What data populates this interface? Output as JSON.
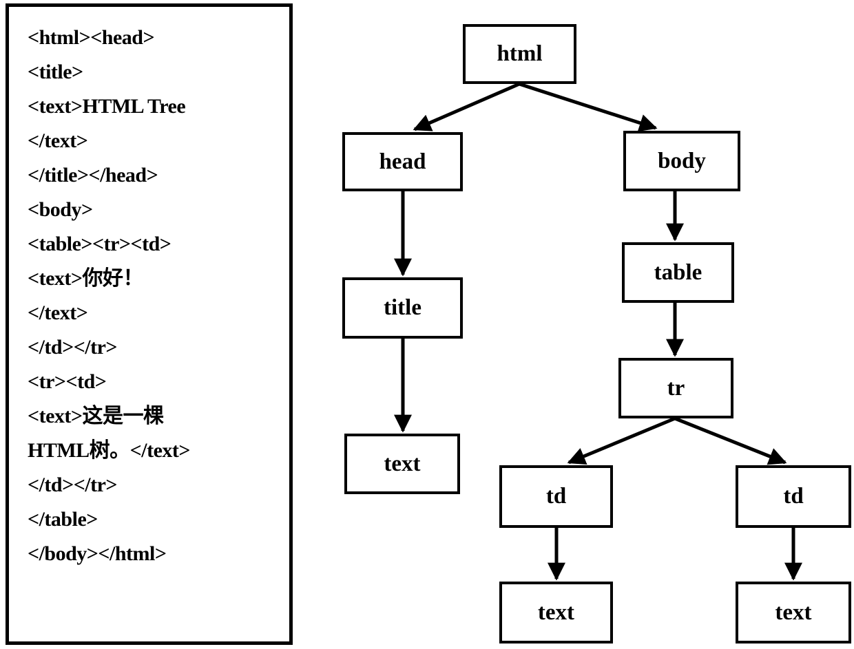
{
  "figure": {
    "kind": "html-dom-tree-diagram",
    "background": "#ffffff",
    "ink": "#000000"
  },
  "code_panel": {
    "lines": [
      "<html><head>",
      "<title>",
      "<text>HTML Tree",
      "</text>",
      "</title></head>",
      "<body>",
      "<table><tr><td>",
      "<text>你好！",
      "</text>",
      "</td></tr>",
      "<tr><td>",
      "<text>这是一棵",
      "HTML树。</text>",
      "</td></tr>",
      "</table>",
      "</body></html>"
    ]
  },
  "tree": {
    "nodes": [
      {
        "id": "html",
        "label": "html"
      },
      {
        "id": "head",
        "label": "head"
      },
      {
        "id": "body",
        "label": "body"
      },
      {
        "id": "title",
        "label": "title"
      },
      {
        "id": "table",
        "label": "table"
      },
      {
        "id": "text1",
        "label": "text"
      },
      {
        "id": "tr",
        "label": "tr"
      },
      {
        "id": "td1",
        "label": "td"
      },
      {
        "id": "td2",
        "label": "td"
      },
      {
        "id": "text2",
        "label": "text"
      },
      {
        "id": "text3",
        "label": "text"
      }
    ],
    "edges": [
      {
        "from": "html",
        "to": "head"
      },
      {
        "from": "html",
        "to": "body"
      },
      {
        "from": "head",
        "to": "title"
      },
      {
        "from": "title",
        "to": "text1"
      },
      {
        "from": "body",
        "to": "table"
      },
      {
        "from": "table",
        "to": "tr"
      },
      {
        "from": "tr",
        "to": "td1"
      },
      {
        "from": "tr",
        "to": "td2"
      },
      {
        "from": "td1",
        "to": "text2"
      },
      {
        "from": "td2",
        "to": "text3"
      }
    ]
  }
}
